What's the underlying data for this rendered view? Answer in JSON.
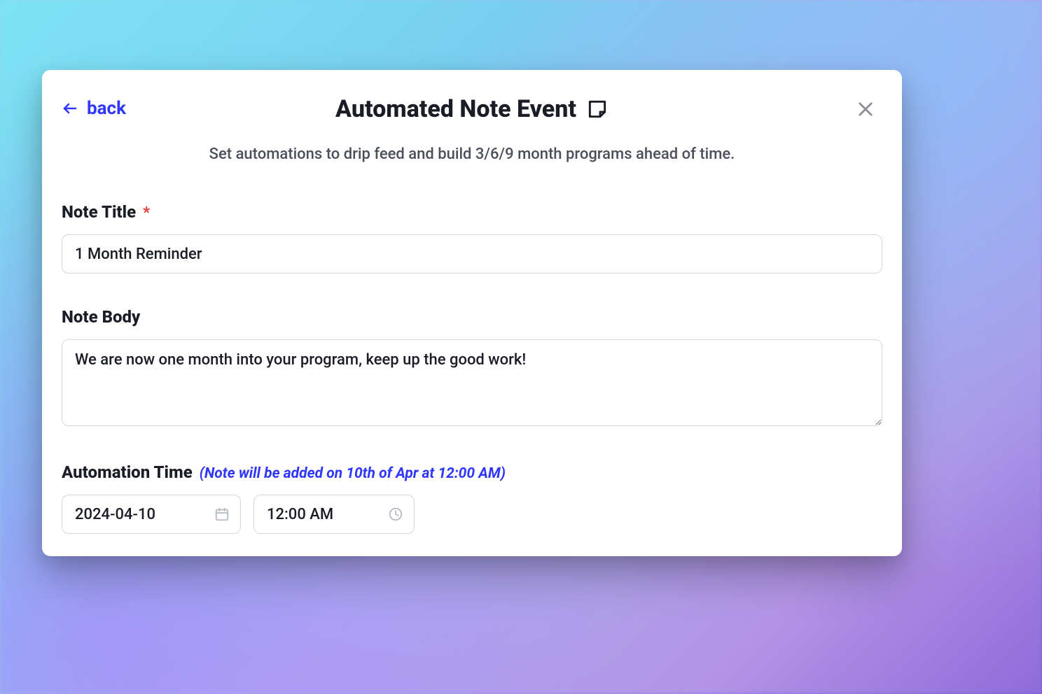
{
  "header": {
    "back_label": "back",
    "title": "Automated Note Event",
    "subtitle": "Set automations to drip feed and build 3/6/9 month programs ahead of time."
  },
  "fields": {
    "note_title": {
      "label": "Note Title",
      "required_marker": "*",
      "value": "1 Month Reminder"
    },
    "note_body": {
      "label": "Note Body",
      "value": "We are now one month into your program, keep up the good work!"
    },
    "automation_time": {
      "label": "Automation Time",
      "hint": "(Note will be added on 10th of Apr at 12:00 AM)",
      "date_value": "2024-04-10",
      "time_value": "12:00 AM"
    }
  }
}
